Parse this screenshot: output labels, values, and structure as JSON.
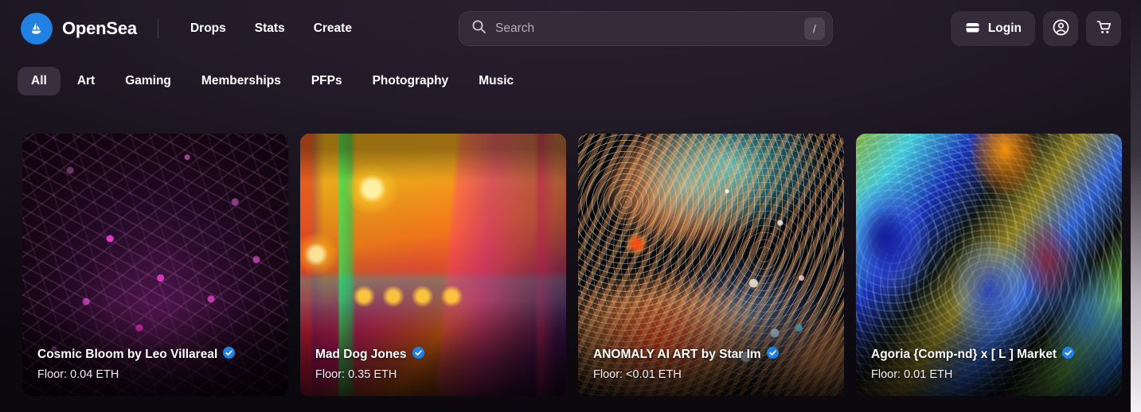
{
  "brand": {
    "name": "OpenSea",
    "logo_icon": "opensea-sailboat-icon",
    "accent": "#2081E2"
  },
  "nav": {
    "items": [
      {
        "label": "Drops"
      },
      {
        "label": "Stats"
      },
      {
        "label": "Create"
      }
    ]
  },
  "search": {
    "placeholder": "Search",
    "value": "",
    "icon": "search-icon",
    "shortcut_key": "/"
  },
  "header_actions": {
    "login_label": "Login",
    "wallet_icon": "wallet-icon",
    "profile_icon": "profile-account-icon",
    "cart_icon": "shopping-cart-icon"
  },
  "tabs": {
    "active": "All",
    "items": [
      {
        "label": "All",
        "active": true
      },
      {
        "label": "Art",
        "active": false
      },
      {
        "label": "Gaming",
        "active": false
      },
      {
        "label": "Memberships",
        "active": false
      },
      {
        "label": "PFPs",
        "active": false
      },
      {
        "label": "Photography",
        "active": false
      },
      {
        "label": "Music",
        "active": false
      }
    ]
  },
  "cards": [
    {
      "title": "Cosmic Bloom by Leo Villareal",
      "floor_label": "Floor: 0.04 ETH",
      "verified": true,
      "art": "art-cosmic"
    },
    {
      "title": "Mad Dog Jones",
      "floor_label": "Floor: 0.35 ETH",
      "verified": true,
      "art": "art-city"
    },
    {
      "title": "ANOMALY AI ART by Star Im",
      "floor_label": "Floor: <0.01 ETH",
      "verified": true,
      "art": "art-flow"
    },
    {
      "title": "Agoria {Comp-nd} x [ L ] Market",
      "floor_label": "Floor: 0.01 ETH",
      "verified": true,
      "art": "art-liquid"
    }
  ]
}
